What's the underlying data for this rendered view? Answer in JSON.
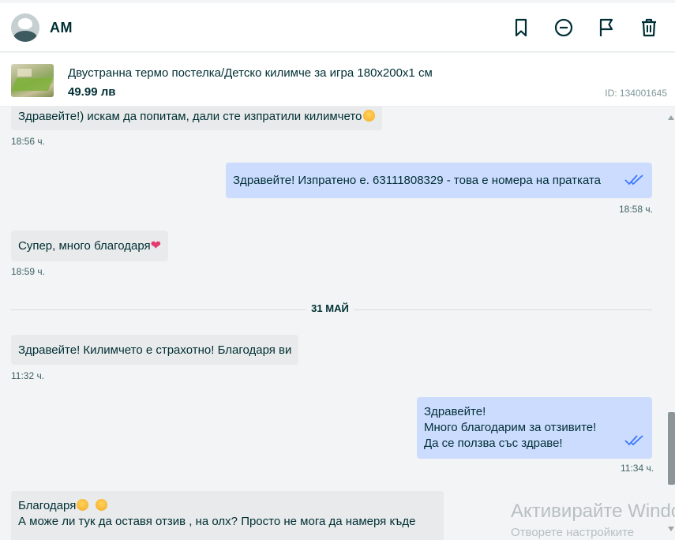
{
  "header": {
    "username": "AM",
    "icons": [
      "bookmark-icon",
      "block-icon",
      "flag-icon",
      "trash-icon"
    ]
  },
  "product": {
    "title": "Двустранна термо постелка/Детско килимче за игра 180x200x1 см",
    "price": "49.99 лв",
    "id": "ID: 134001645"
  },
  "messages": [
    {
      "direction": "in",
      "text": "Здравейте!) искам да попитам, дали сте изпратили килимчето",
      "emoji": "smile",
      "time": "18:56 ч."
    },
    {
      "direction": "out",
      "text": "Здравейте! Изпратено е. 63111808329 - това е номера на пратката",
      "time": "18:58 ч.",
      "read": true
    },
    {
      "direction": "in",
      "text": "Супер, много благодаря",
      "emoji": "heart",
      "time": "18:59 ч."
    },
    {
      "day_separator": "31 МАЙ"
    },
    {
      "direction": "in",
      "text": "Здравейте! Килимчето е страхотно! Благодаря ви",
      "time": "11:32 ч."
    },
    {
      "direction": "out",
      "lines": [
        "Здравейте!",
        "Много благодарим за отзивите!",
        "Да се ползва със здраве!"
      ],
      "time": "11:34 ч.",
      "read": true
    },
    {
      "direction": "in",
      "lines": [
        "Благодаря",
        "А може ли тук да оставя отзив , на олх? Просто не мога да намеря къде"
      ],
      "emoji": "smile"
    }
  ],
  "watermark": {
    "line1": "Активирайте Windows",
    "line2": "Отворете настройките"
  },
  "colors": {
    "incoming_bubble": "#e8eaeb",
    "outgoing_bubble": "#ccdcff",
    "text": "#002f34",
    "read_ticks": "#3a77ff"
  }
}
